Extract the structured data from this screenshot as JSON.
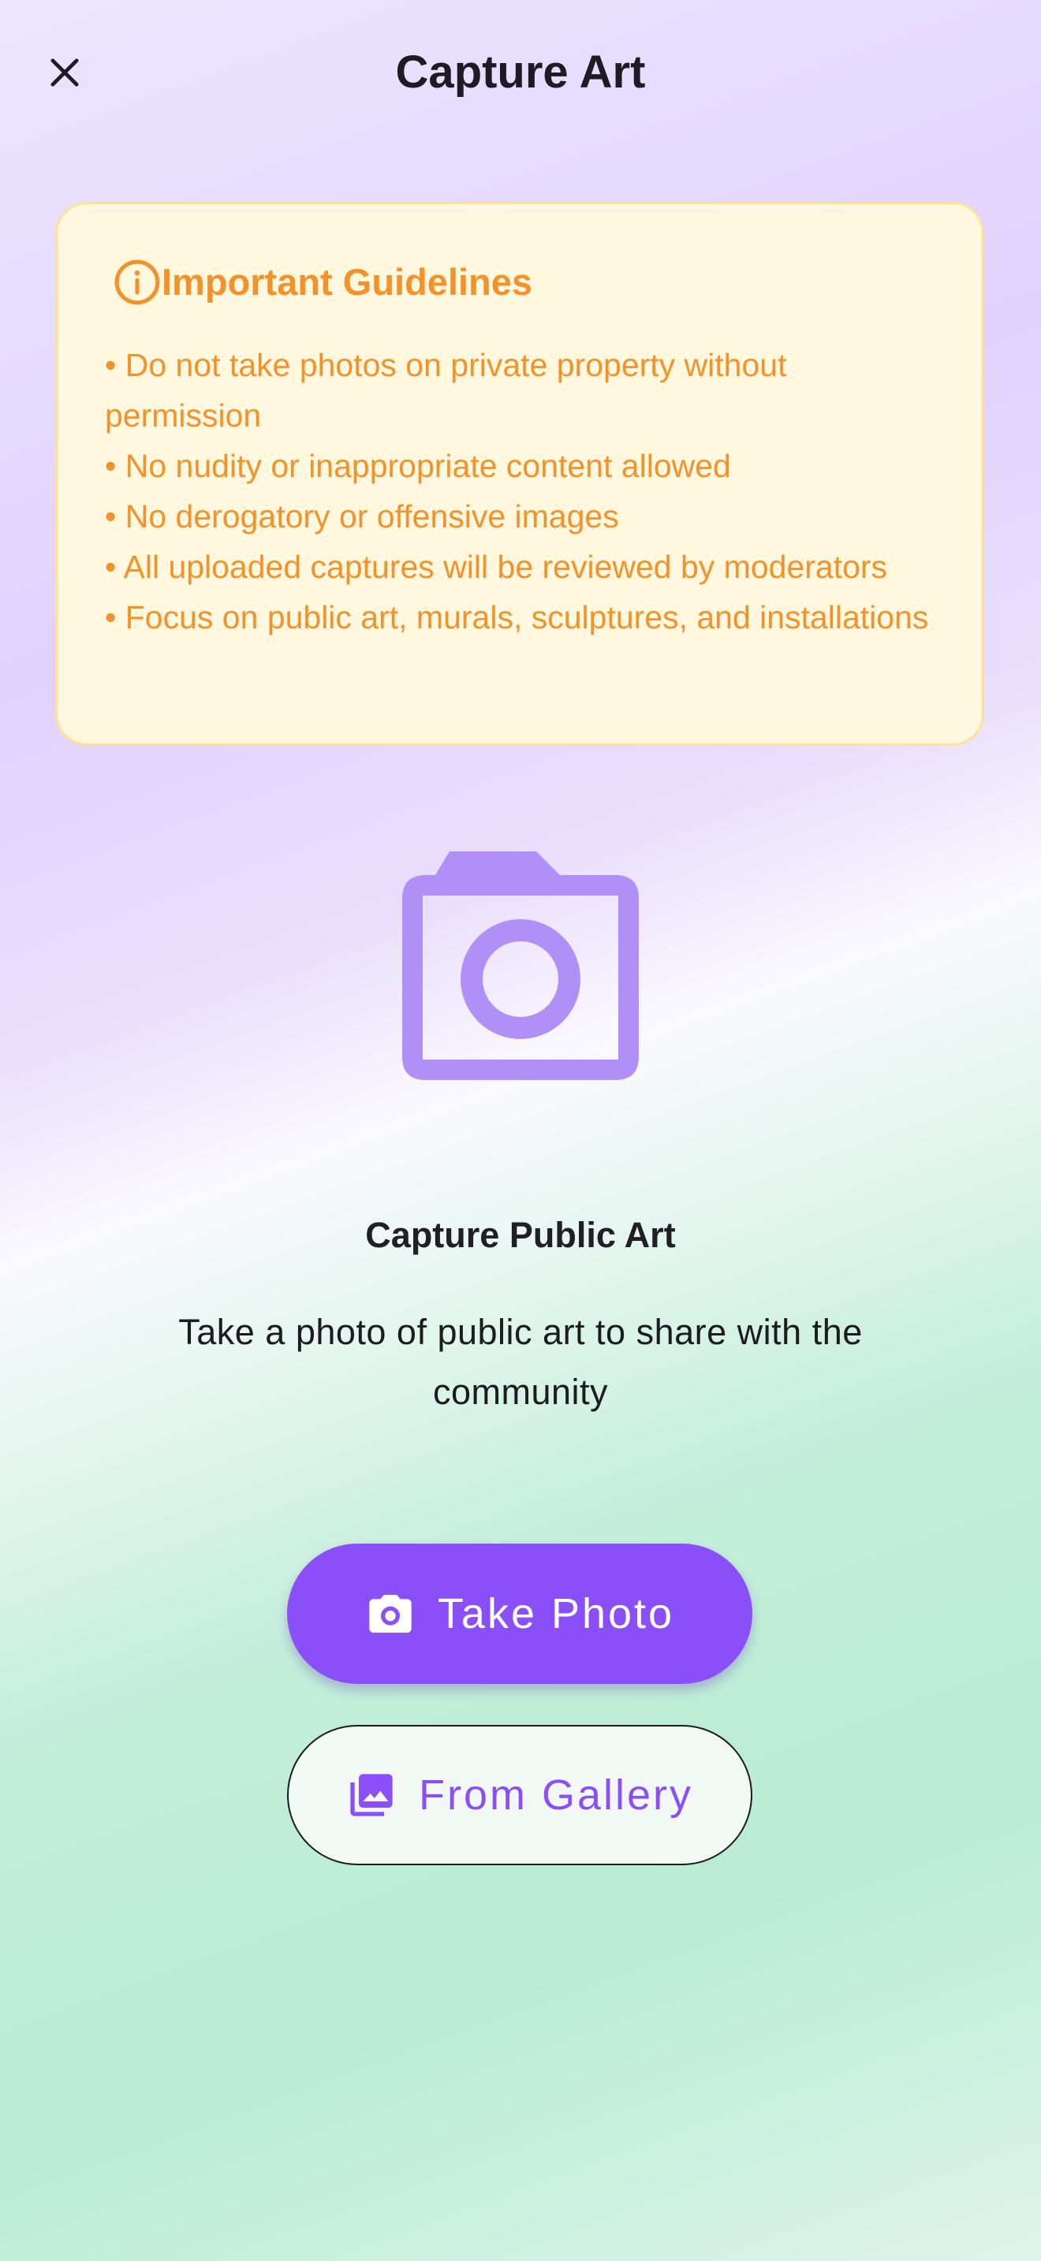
{
  "header": {
    "title": "Capture Art",
    "close_icon": "close-icon"
  },
  "guidelines": {
    "icon": "info-icon",
    "title": "Important Guidelines",
    "items": [
      "• Do not take photos on private property without permission",
      "• No nudity or inappropriate content allowed",
      "• No derogatory or offensive images",
      "• All uploaded captures will be reviewed by moderators",
      "• Focus on public art, murals, sculptures, and installations"
    ]
  },
  "hero": {
    "icon": "camera-icon",
    "title": "Capture Public Art",
    "description": "Take a photo of public art to share with the community"
  },
  "actions": {
    "take_photo": {
      "label": "Take Photo",
      "icon": "camera-icon"
    },
    "from_gallery": {
      "label": "From Gallery",
      "icon": "gallery-icon"
    }
  },
  "colors": {
    "accent": "#8a4ff8",
    "guideline_text": "#f4922a",
    "guideline_bg": "#fff7de",
    "camera_icon": "#b08ff6"
  }
}
